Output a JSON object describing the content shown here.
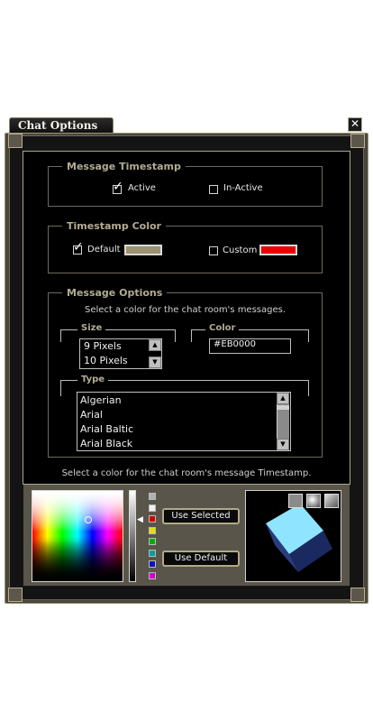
{
  "window": {
    "title": "Chat Options",
    "close_glyph": "✕"
  },
  "timestamp": {
    "title": "Message Timestamp",
    "active_label": "Active",
    "active_checked": true,
    "inactive_label": "In-Active",
    "inactive_checked": false
  },
  "timestamp_color": {
    "title": "Timestamp Color",
    "default_label": "Default",
    "default_checked": true,
    "default_swatch": "#9a9270",
    "custom_label": "Custom",
    "custom_checked": false,
    "custom_swatch": "#eb0000"
  },
  "message_options": {
    "title": "Message Options",
    "description": "Select a color for the chat room's messages.",
    "size": {
      "label": "Size",
      "items": [
        "9 Pixels",
        "10 Pixels"
      ]
    },
    "color": {
      "label": "Color",
      "value": "#EB0000"
    },
    "type": {
      "label": "Type",
      "items": [
        "Algerian",
        "Arial",
        "Arial Baltic",
        "Arial Black"
      ]
    }
  },
  "picker": {
    "hint": "Select a color for the chat room's message Timestamp.",
    "use_selected_label": "Use Selected",
    "use_default_label": "Use Default",
    "presets": [
      "#b0b0b0",
      "#f0f0f0",
      "#d00000",
      "#e0e000",
      "#00b000",
      "#00a0a0",
      "#1010c0",
      "#d000d0"
    ],
    "preview_cube_color": "#1a2a60",
    "preview_highlight": "#8fe4ff"
  }
}
